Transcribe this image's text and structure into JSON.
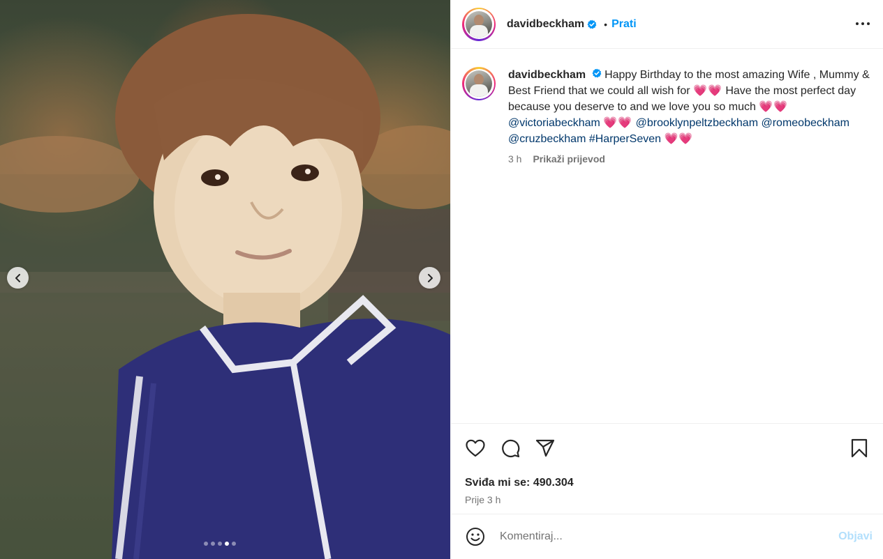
{
  "media": {
    "prev_label": "‹",
    "next_label": "›",
    "slide_count": 5,
    "active_slide": 4
  },
  "header": {
    "username": "davidbeckham",
    "bullet": "•",
    "follow_label": "Prati",
    "more_icon": "more-horizontal-icon"
  },
  "caption": {
    "username": "davidbeckham",
    "text_1": "Happy Birthday to the most amazing Wife , Mummy & Best Friend that we could all wish for",
    "text_2": "Have the most perfect day because you deserve to and we love you so much",
    "hearts": "💗💗",
    "mentions": [
      "@victoriabeckham",
      "@brooklynpeltzbeckham",
      "@romeobeckham",
      "@cruzbeckham"
    ],
    "hashtag": "#HarperSeven",
    "time": "3 h",
    "translate_label": "Prikaži prijevod"
  },
  "actions": {
    "likes": "Sviđa mi se: 490.304",
    "time_ago": "Prije 3 h"
  },
  "comment": {
    "placeholder": "Komentiraj...",
    "post_label": "Objavi"
  },
  "colors": {
    "accent": "#0095f6",
    "verified": "#0095f6",
    "mention": "#00376b",
    "post_disabled": "#b2dffc"
  }
}
